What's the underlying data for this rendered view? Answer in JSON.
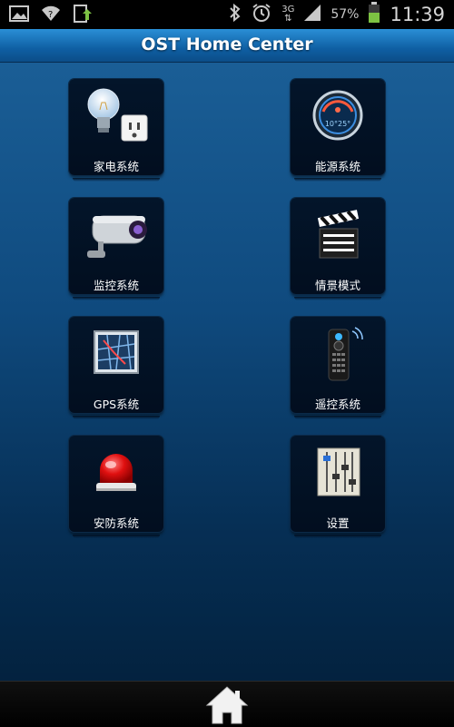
{
  "status_bar": {
    "battery_percent": "57%",
    "time": "11:39",
    "network": "3G",
    "icons": [
      "gallery-icon",
      "wifi-icon",
      "download-icon",
      "bluetooth-icon",
      "alarm-icon",
      "network-3g-icon",
      "signal-icon",
      "battery-icon"
    ]
  },
  "header": {
    "title": "OST Home Center"
  },
  "grid": {
    "items": [
      {
        "label": "家电系统",
        "icon": "appliance-icon"
      },
      {
        "label": "能源系统",
        "icon": "energy-meter-icon"
      },
      {
        "label": "监控系统",
        "icon": "camera-icon"
      },
      {
        "label": "情景模式",
        "icon": "clapperboard-icon"
      },
      {
        "label": "GPS系统",
        "icon": "map-icon"
      },
      {
        "label": "遥控系统",
        "icon": "remote-control-icon"
      },
      {
        "label": "安防系统",
        "icon": "alarm-light-icon"
      },
      {
        "label": "设置",
        "icon": "equalizer-settings-icon"
      }
    ]
  },
  "bottom_nav": {
    "icon": "home-icon"
  },
  "colors": {
    "title_bar": "#1a78c2",
    "background_top": "#1a5e96",
    "background_bottom": "#03223f",
    "tile": "#020e1f"
  }
}
